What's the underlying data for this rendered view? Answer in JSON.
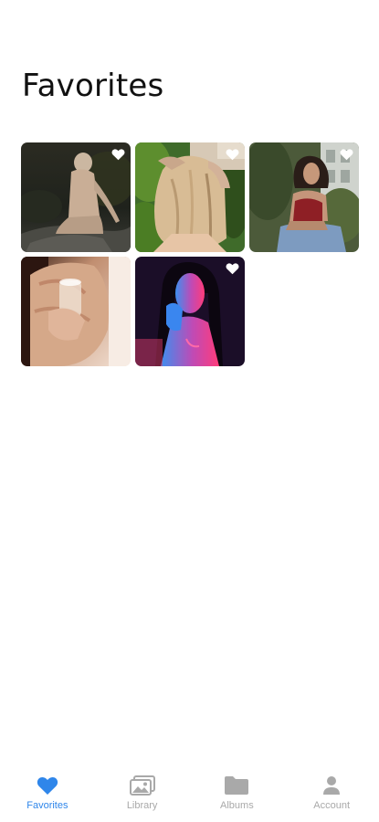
{
  "page": {
    "title": "Favorites"
  },
  "photos": [
    {
      "name": "photo-1",
      "favorited": true,
      "subject": "woman seated on dark rocks, back view"
    },
    {
      "name": "photo-2",
      "favorited": true,
      "subject": "blonde hair among green leaves"
    },
    {
      "name": "photo-3",
      "favorited": true,
      "subject": "woman in red top seated outdoors"
    },
    {
      "name": "photo-4",
      "favorited": false,
      "subject": "hand holding a glass, warm tones"
    },
    {
      "name": "photo-5",
      "favorited": true,
      "subject": "portrait with neon pink and blue lighting"
    }
  ],
  "tabbar": {
    "active": "favorites",
    "active_color": "#2f86ea",
    "inactive_color": "#a9a9a9",
    "items": [
      {
        "id": "favorites",
        "label": "Favorites",
        "icon": "heart-icon"
      },
      {
        "id": "library",
        "label": "Library",
        "icon": "photos-stack-icon"
      },
      {
        "id": "albums",
        "label": "Albums",
        "icon": "folder-icon"
      },
      {
        "id": "account",
        "label": "Account",
        "icon": "person-icon"
      }
    ]
  }
}
